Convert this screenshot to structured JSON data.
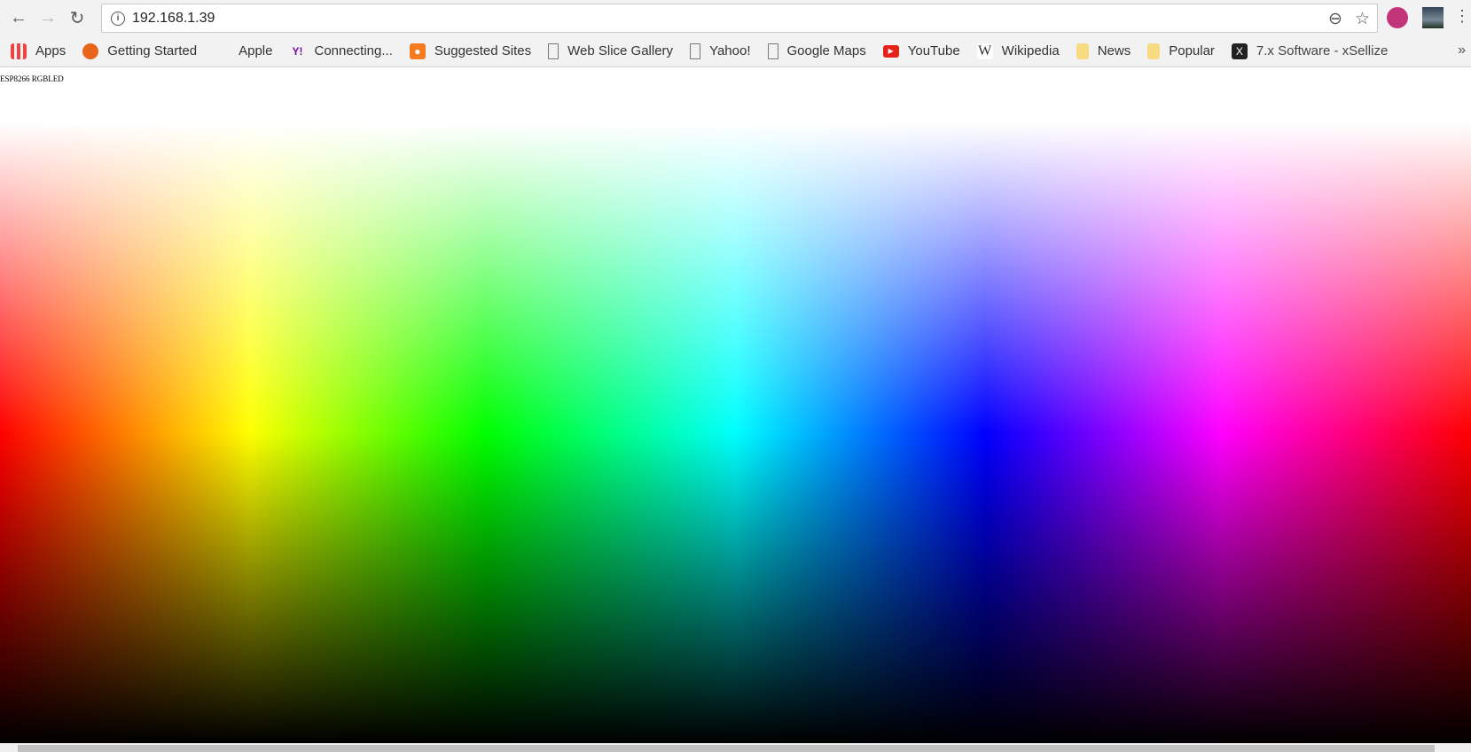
{
  "browser": {
    "url": "192.168.1.39",
    "bookmarks": [
      {
        "label": "Apps",
        "icon": "apps-grid-icon"
      },
      {
        "label": "Getting Started",
        "icon": "firefox-icon"
      },
      {
        "label": "Apple",
        "icon": "apple-icon"
      },
      {
        "label": "Connecting...",
        "icon": "yahoo-icon"
      },
      {
        "label": "Suggested Sites",
        "icon": "suggested-sites-icon"
      },
      {
        "label": "Web Slice Gallery",
        "icon": "page-icon"
      },
      {
        "label": "Yahoo!",
        "icon": "page-icon"
      },
      {
        "label": "Google Maps",
        "icon": "page-icon"
      },
      {
        "label": "YouTube",
        "icon": "youtube-icon"
      },
      {
        "label": "Wikipedia",
        "icon": "wikipedia-icon"
      },
      {
        "label": "News",
        "icon": "folder-icon"
      },
      {
        "label": "Popular",
        "icon": "folder-icon"
      },
      {
        "label": "7.x Software - xSellize",
        "icon": "xsellize-icon"
      }
    ],
    "overflow": "»"
  },
  "page": {
    "title": "ESP8266 RGBLED"
  },
  "colors": {
    "red": "#ff0000",
    "yellow": "#ffff00",
    "green": "#00ff00",
    "cyan": "#00ffff",
    "blue": "#0000ff",
    "magenta": "#ff00ff"
  }
}
